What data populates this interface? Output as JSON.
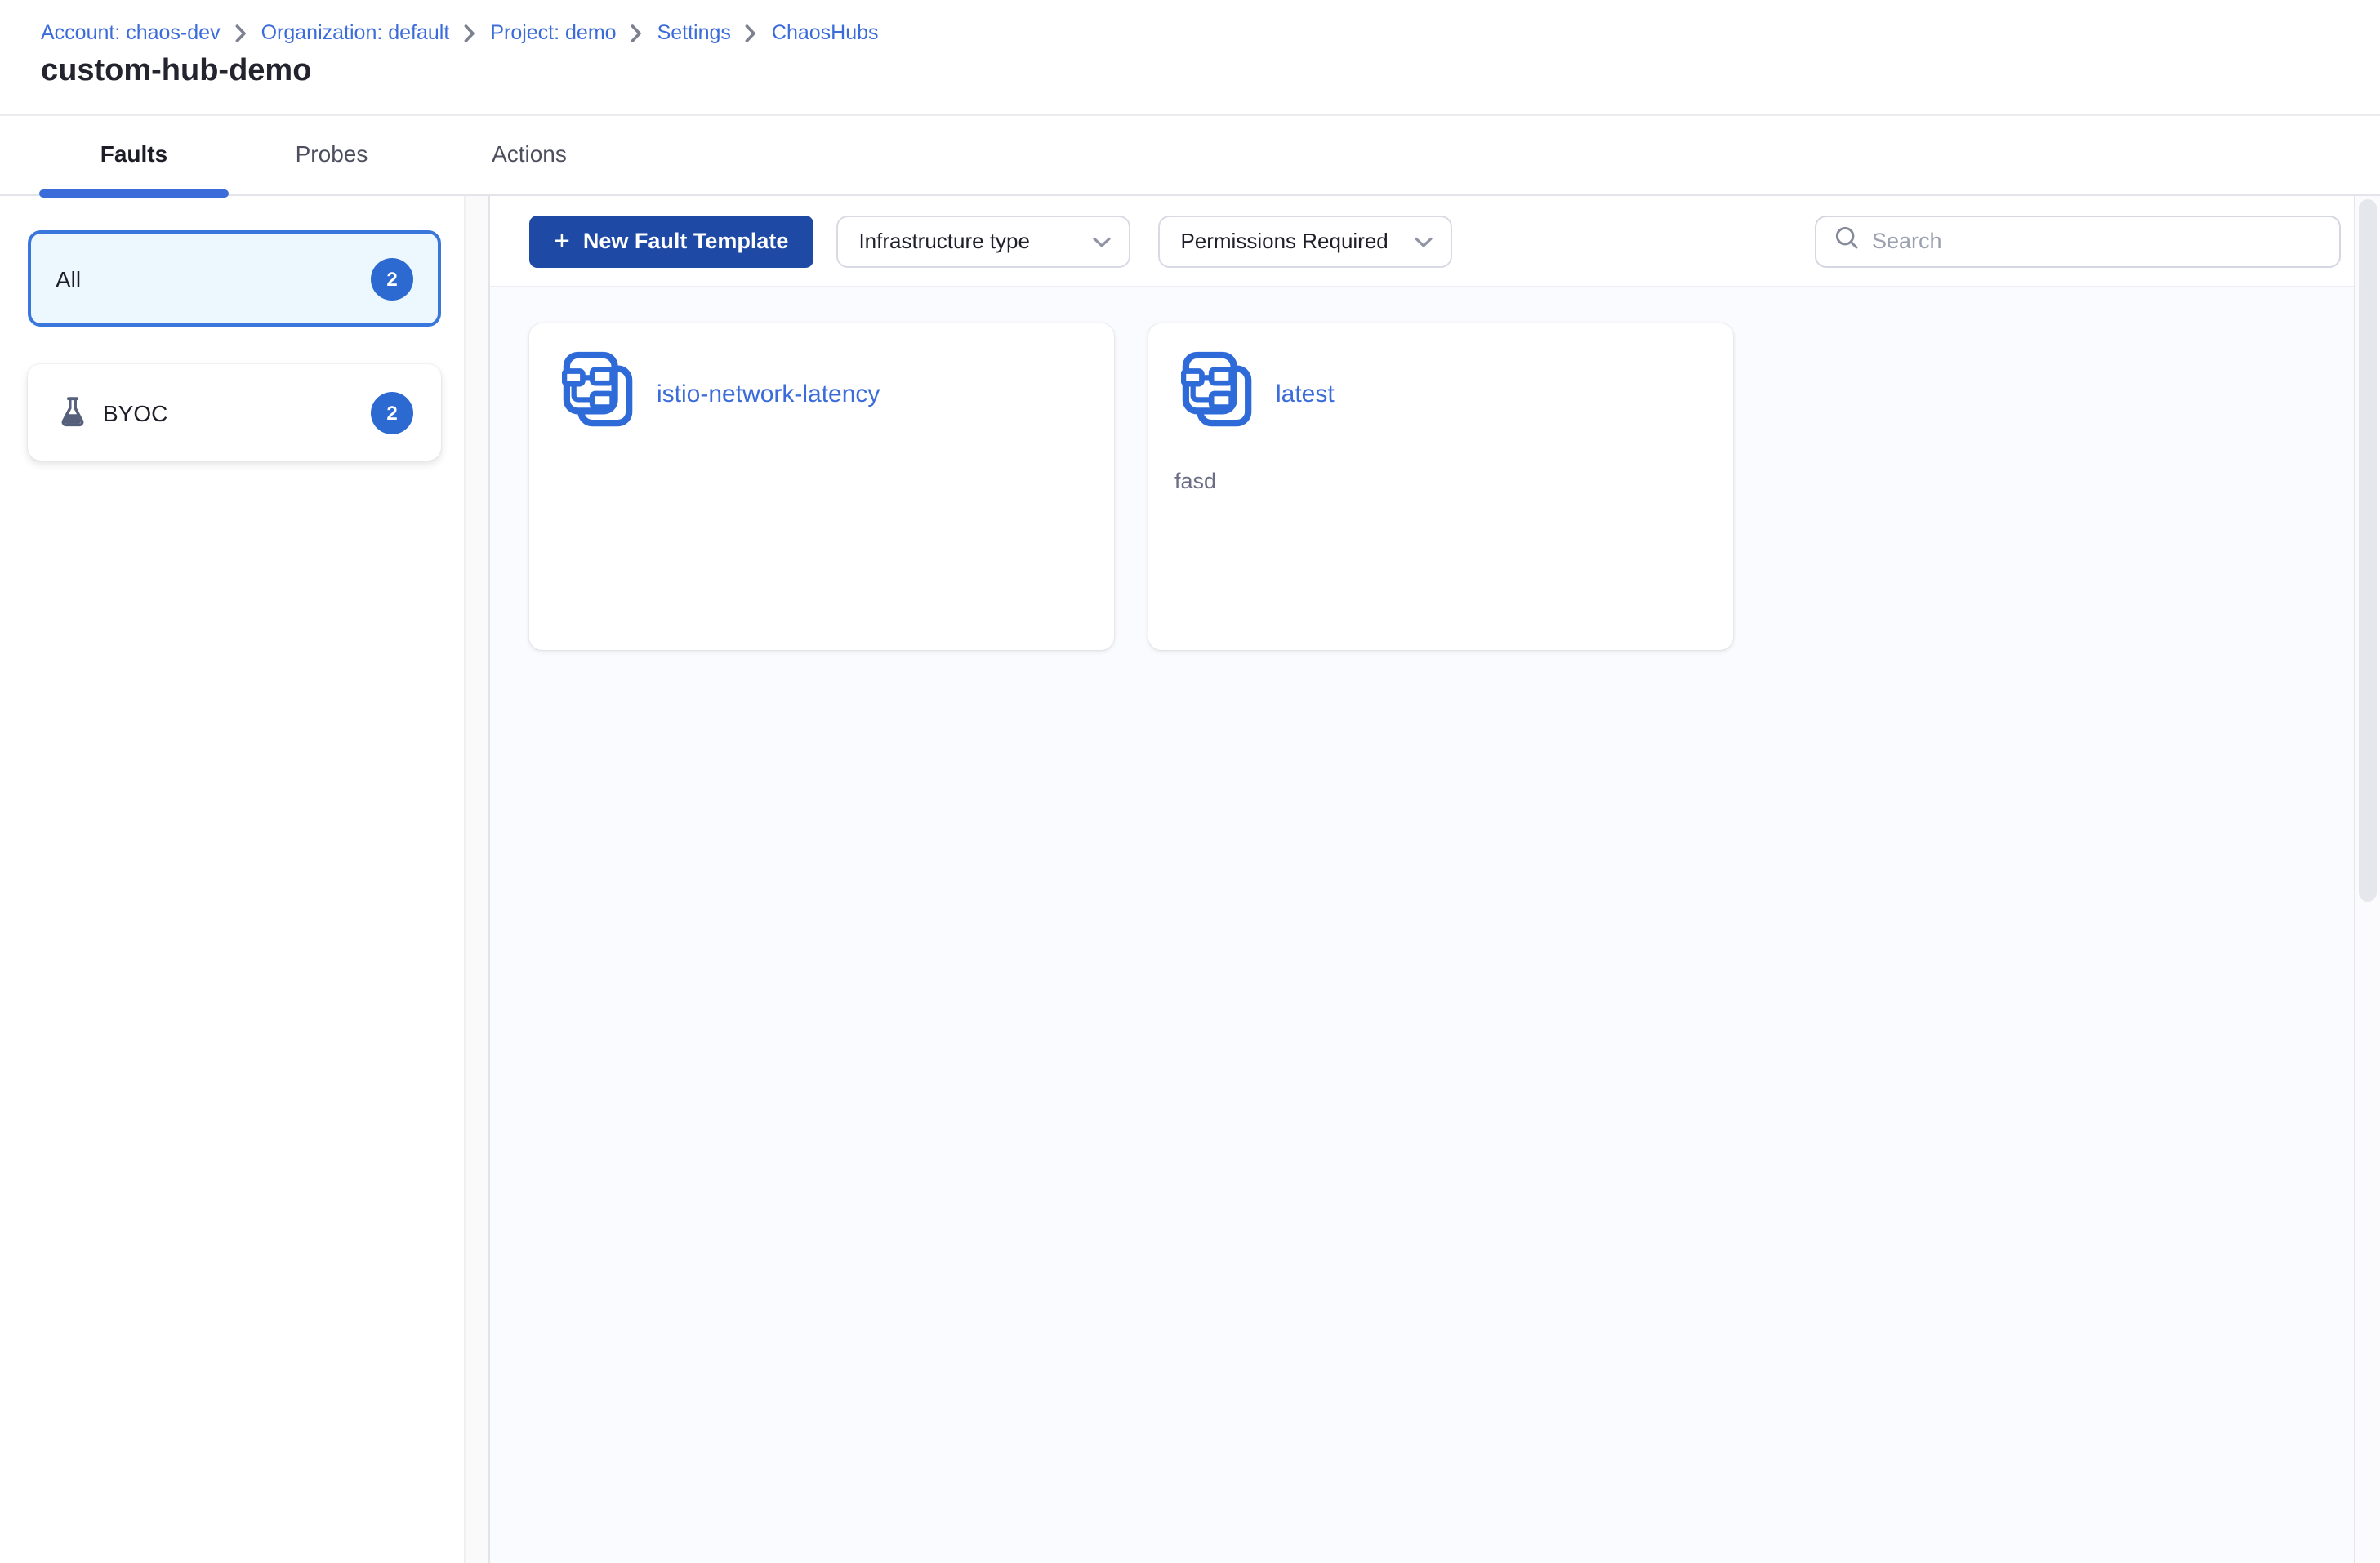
{
  "colors": {
    "primary_button": "#1e49a5",
    "link_blue": "#3b6cd9",
    "badge_blue": "#2c6ad2",
    "selected_filter_bg": "#edf7fe",
    "selected_filter_border": "#3a77dd",
    "template_icon_blue": "#2e6bd8",
    "flask_icon_gray": "#55607a",
    "main_bg": "#fafbfe"
  },
  "breadcrumb": {
    "items": [
      {
        "label": "Account: chaos-dev"
      },
      {
        "label": "Organization: default"
      },
      {
        "label": "Project: demo"
      },
      {
        "label": "Settings"
      },
      {
        "label": "ChaosHubs"
      }
    ]
  },
  "page": {
    "title": "custom-hub-demo"
  },
  "tabs": [
    {
      "label": "Faults",
      "active": true
    },
    {
      "label": "Probes",
      "active": false
    },
    {
      "label": "Actions",
      "active": false
    }
  ],
  "sidebar": {
    "filters": [
      {
        "label": "All",
        "count": "2",
        "selected": true
      },
      {
        "label": "BYOC",
        "count": "2",
        "selected": false,
        "icon": "flask-icon"
      }
    ]
  },
  "toolbar": {
    "new_template_button": {
      "plus": "+",
      "label": "New Fault Template"
    },
    "dropdowns": [
      {
        "label": "Infrastructure type"
      },
      {
        "label": "Permissions Required"
      }
    ],
    "search": {
      "placeholder": "Search",
      "value": ""
    }
  },
  "templates": [
    {
      "title": "istio-network-latency",
      "description": ""
    },
    {
      "title": "latest",
      "description": "fasd"
    }
  ]
}
